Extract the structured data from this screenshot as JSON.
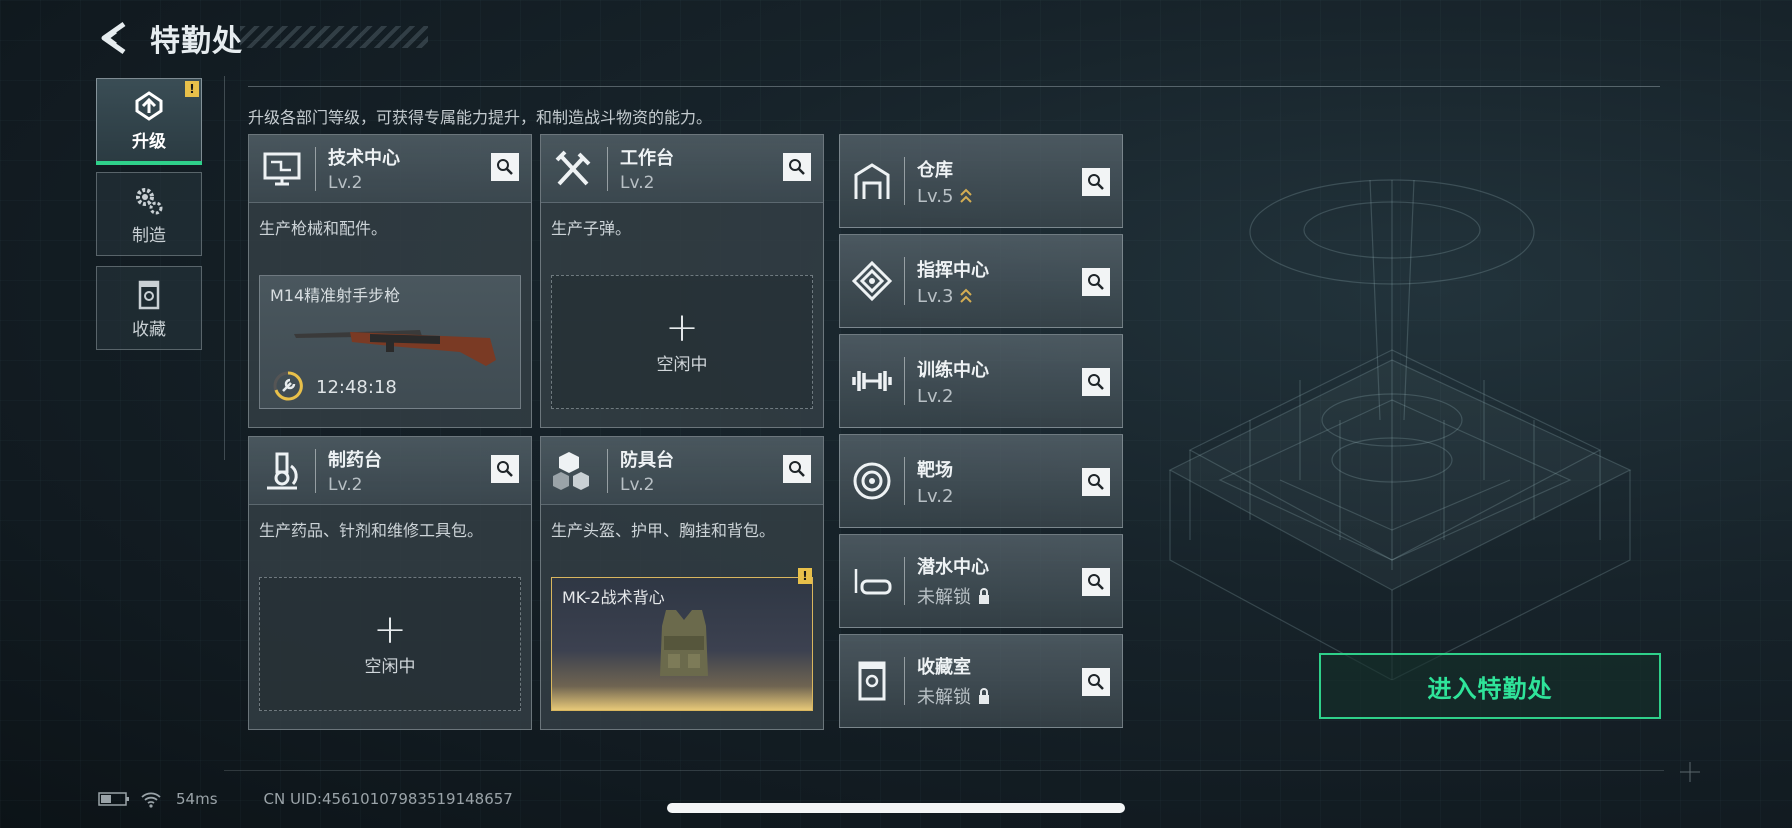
{
  "header": {
    "title": "特勤处"
  },
  "subtitle": "升级各部门等级，可获得专属能力提升，和制造战斗物资的能力。",
  "nav": [
    {
      "label": "升级",
      "icon": "upgrade-icon",
      "active": true,
      "badge": "!"
    },
    {
      "label": "制造",
      "icon": "gears-icon",
      "active": false
    },
    {
      "label": "收藏",
      "icon": "collection-icon",
      "active": false
    }
  ],
  "facilities": [
    {
      "name": "技术中心",
      "level": "Lv.2",
      "icon": "computer-icon",
      "desc": "生产枪械和配件。",
      "slot": {
        "state": "producing",
        "item": "M14精准射手步枪",
        "timer": "12:48:18"
      }
    },
    {
      "name": "工作台",
      "level": "Lv.2",
      "icon": "tools-icon",
      "desc": "生产子弹。",
      "slot": {
        "state": "idle",
        "plus": "+",
        "text": "空闲中"
      }
    },
    {
      "name": "制药台",
      "level": "Lv.2",
      "icon": "microscope-icon",
      "desc": "生产药品、针剂和维修工具包。",
      "slot": {
        "state": "idle",
        "plus": "+",
        "text": "空闲中"
      }
    },
    {
      "name": "防具台",
      "level": "Lv.2",
      "icon": "cubes-icon",
      "desc": "生产头盔、护甲、胸挂和背包。",
      "slot": {
        "state": "ready",
        "item": "MK-2战术背心",
        "badge": "!"
      }
    }
  ],
  "side_facilities": [
    {
      "name": "仓库",
      "level": "Lv.5",
      "upgradable": true,
      "icon": "warehouse-icon"
    },
    {
      "name": "指挥中心",
      "level": "Lv.3",
      "upgradable": true,
      "icon": "command-icon"
    },
    {
      "name": "训练中心",
      "level": "Lv.2",
      "upgradable": false,
      "icon": "dumbbell-icon"
    },
    {
      "name": "靶场",
      "level": "Lv.2",
      "upgradable": false,
      "icon": "target-icon"
    },
    {
      "name": "潜水中心",
      "level": "未解锁",
      "locked": true,
      "icon": "diving-mask-icon"
    },
    {
      "name": "收藏室",
      "level": "未解锁",
      "locked": true,
      "icon": "collection-room-icon"
    }
  ],
  "enter_button": "进入特勤处",
  "status": {
    "ping": "54ms",
    "uid": "CN UID:45610107983519148657"
  },
  "colors": {
    "accent": "#2fd08a",
    "warning": "#e8c04a",
    "armor_frame": "#d9b65e"
  }
}
